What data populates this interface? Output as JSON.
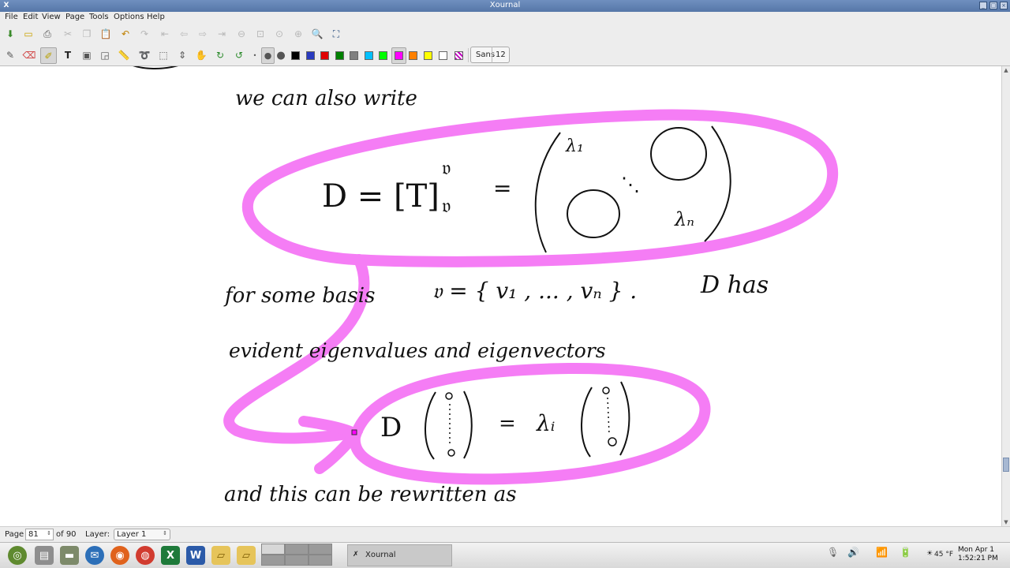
{
  "window": {
    "title": "Xournal",
    "app_icon": "X"
  },
  "menu": [
    "File",
    "Edit",
    "View",
    "Page",
    "Tools",
    "Options",
    "Help"
  ],
  "toolbar1": [
    "save-icon",
    "new-icon",
    "print-icon",
    "cut-icon",
    "copy-icon",
    "paste-icon",
    "undo-icon",
    "redo-icon",
    "first-page-icon",
    "prev-page-icon",
    "next-page-icon",
    "last-page-icon",
    "zoom-out-icon",
    "zoom-100-icon",
    "zoom-width-icon",
    "zoom-in-icon",
    "zoom-search-icon",
    "fullscreen-icon"
  ],
  "toolbar2": {
    "tools": [
      "pen-icon",
      "eraser-icon",
      "highlighter-icon",
      "text-icon",
      "image-icon",
      "shapes-icon",
      "ruler-icon",
      "lasso-icon",
      "rect-select-icon",
      "vertical-space-icon",
      "hand-icon",
      "default-pen-icon",
      "default-highlighter-icon"
    ],
    "colors": [
      "#000000",
      "#2a3bbf",
      "#e00000",
      "#008000",
      "#808080",
      "#00c0ff",
      "#00ff00",
      "#ff00ff",
      "#ff8000",
      "#ffff00",
      "#ffffff",
      "#c000c0"
    ],
    "active_color": "#ff00ff",
    "font_name": "Sans",
    "font_size": "12"
  },
  "notes": {
    "line1": "we can also write",
    "eq1_lhs": "D = [T]",
    "eq1_sup": "𝔳",
    "eq1_sub": "𝔳",
    "eq1_eq": "=",
    "matrix_l1": "λ₁",
    "matrix_ln": "λₙ",
    "matrix_dots": "⋱",
    "line2": "for some basis",
    "basis": "𝔳 = { v₁ , ... , vₙ } .",
    "dhas": "D has",
    "line3": "evident eigenvalues and eigenvectors",
    "eq2_d": "D",
    "eq2_eq": "=",
    "eq2_lambda": "λᵢ",
    "line4": "and this can be rewritten as",
    "highlight_color": "#f57df5"
  },
  "status": {
    "page_label": "Page",
    "page_value": "81",
    "page_of": "of 90",
    "layer_label": "Layer:",
    "layer_value": "Layer 1"
  },
  "taskbar": {
    "task_title": "Xournal",
    "temp": "45 °F",
    "clock_line1": "Mon Apr  1",
    "clock_line2": "1:52:21 PM"
  }
}
